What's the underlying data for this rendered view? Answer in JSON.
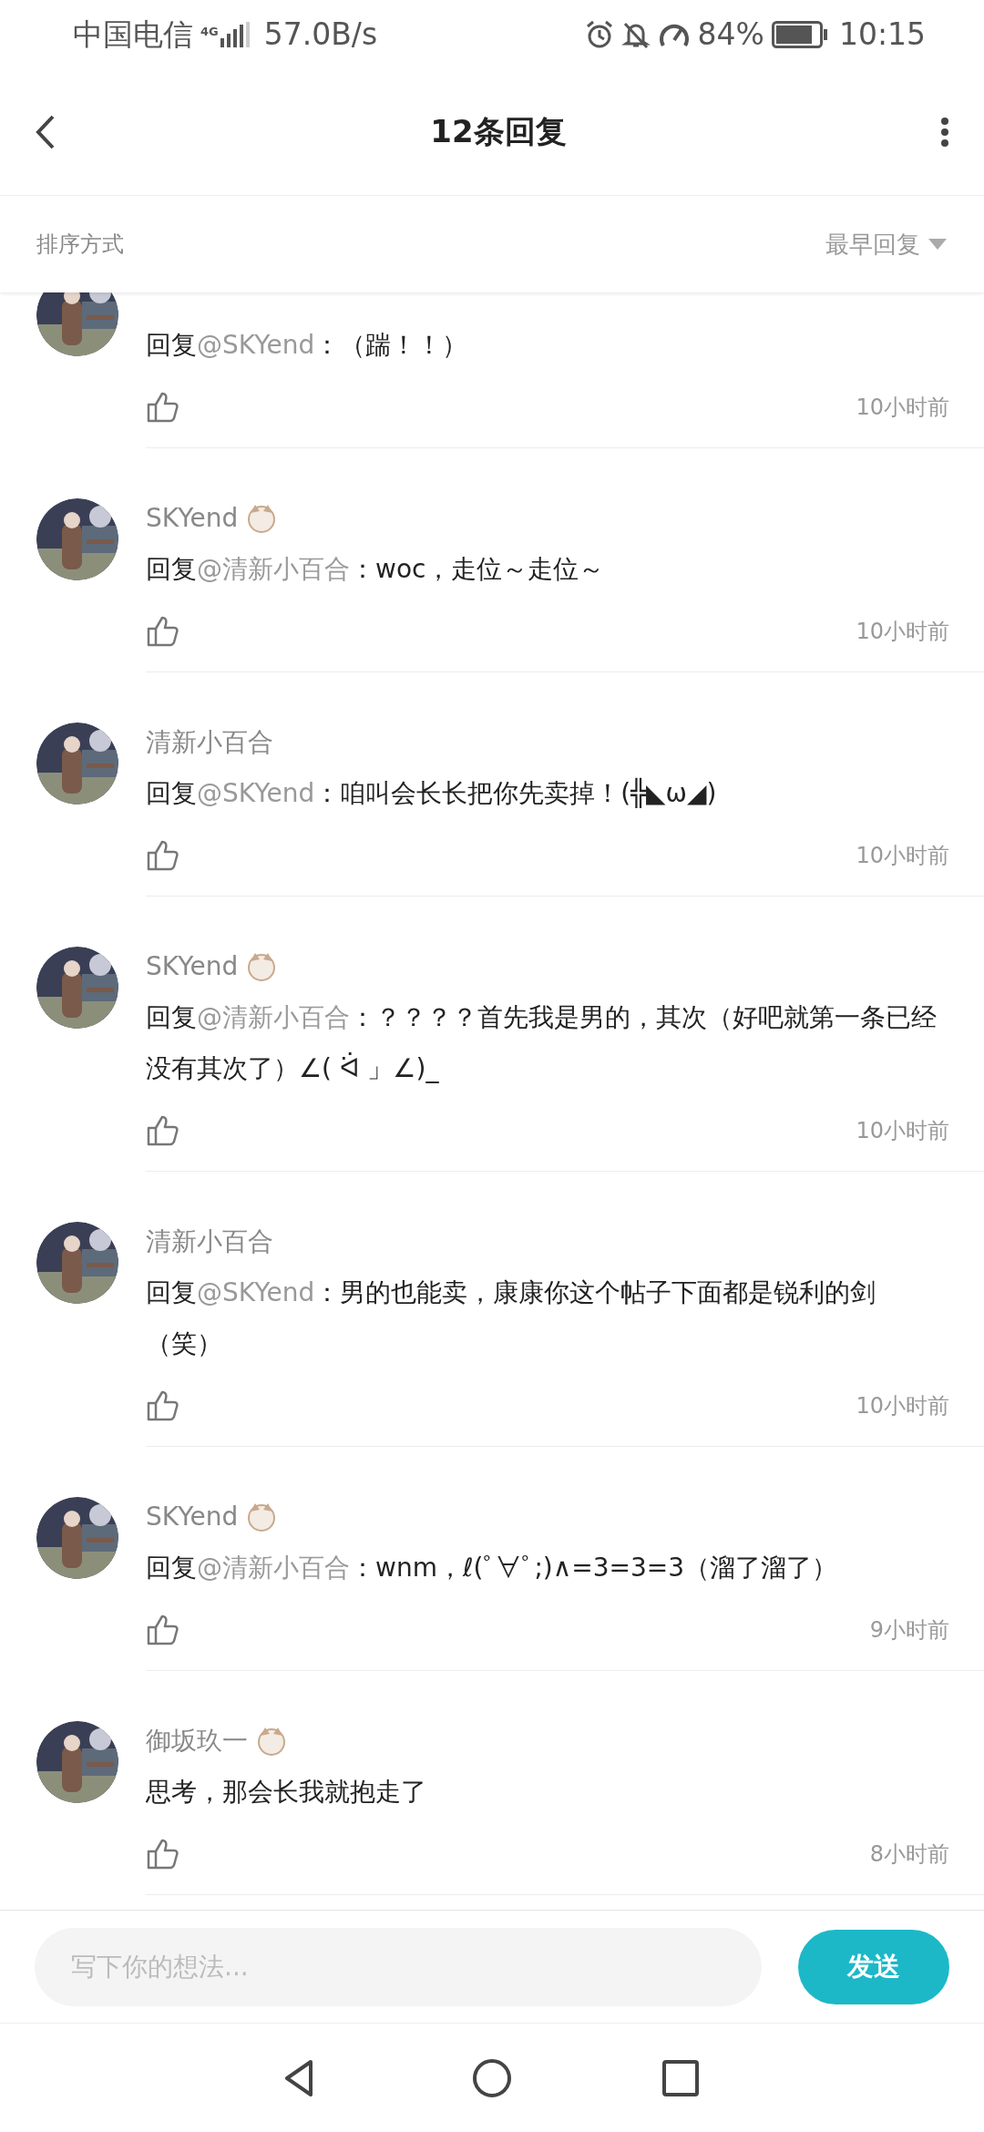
{
  "status_bar": {
    "carrier": "中国电信",
    "network": "4G",
    "speed": "57.0B/s",
    "battery": "84%",
    "time": "10:15"
  },
  "header": {
    "title": "12条回复"
  },
  "sort": {
    "label": "排序方式",
    "value": "最早回复"
  },
  "comments": [
    {
      "badge": false,
      "prefix": "回复",
      "mention": "@SKYend",
      "body": "：（踹！！）",
      "liked": false,
      "time": "10小时前"
    },
    {
      "author": "SKYend",
      "badge": true,
      "prefix": "回复",
      "mention": "@清新小百合",
      "body": "：woc，走位～走位～",
      "liked": false,
      "time": "10小时前"
    },
    {
      "author": "清新小百合",
      "badge": false,
      "prefix": "回复",
      "mention": "@SKYend",
      "body": "：咱叫会长长把你先卖掉！(╬◣ω◢)",
      "liked": false,
      "time": "10小时前"
    },
    {
      "author": "SKYend",
      "badge": true,
      "prefix": "回复",
      "mention": "@清新小百合",
      "body": "：？？？？首先我是男的，其次（好吧就第一条已经没有其次了）∠( ᐛ 」∠)_",
      "liked": false,
      "time": "10小时前"
    },
    {
      "author": "清新小百合",
      "badge": false,
      "prefix": "回复",
      "mention": "@SKYend",
      "body": "：男的也能卖，康康你这个帖子下面都是锐利的剑（笑）",
      "liked": false,
      "time": "10小时前"
    },
    {
      "author": "SKYend",
      "badge": true,
      "prefix": "回复",
      "mention": "@清新小百合",
      "body": "：wnm，ℓ(ﾟ∀ﾟ;)∧=3=3=3（溜了溜了）",
      "liked": false,
      "time": "9小时前"
    },
    {
      "author": "御坂玖一",
      "badge": true,
      "body": "思考，那会长我就抱走了",
      "liked": false,
      "time": "8小时前"
    }
  ],
  "composer": {
    "placeholder": "写下你的想法...",
    "send": "发送"
  }
}
